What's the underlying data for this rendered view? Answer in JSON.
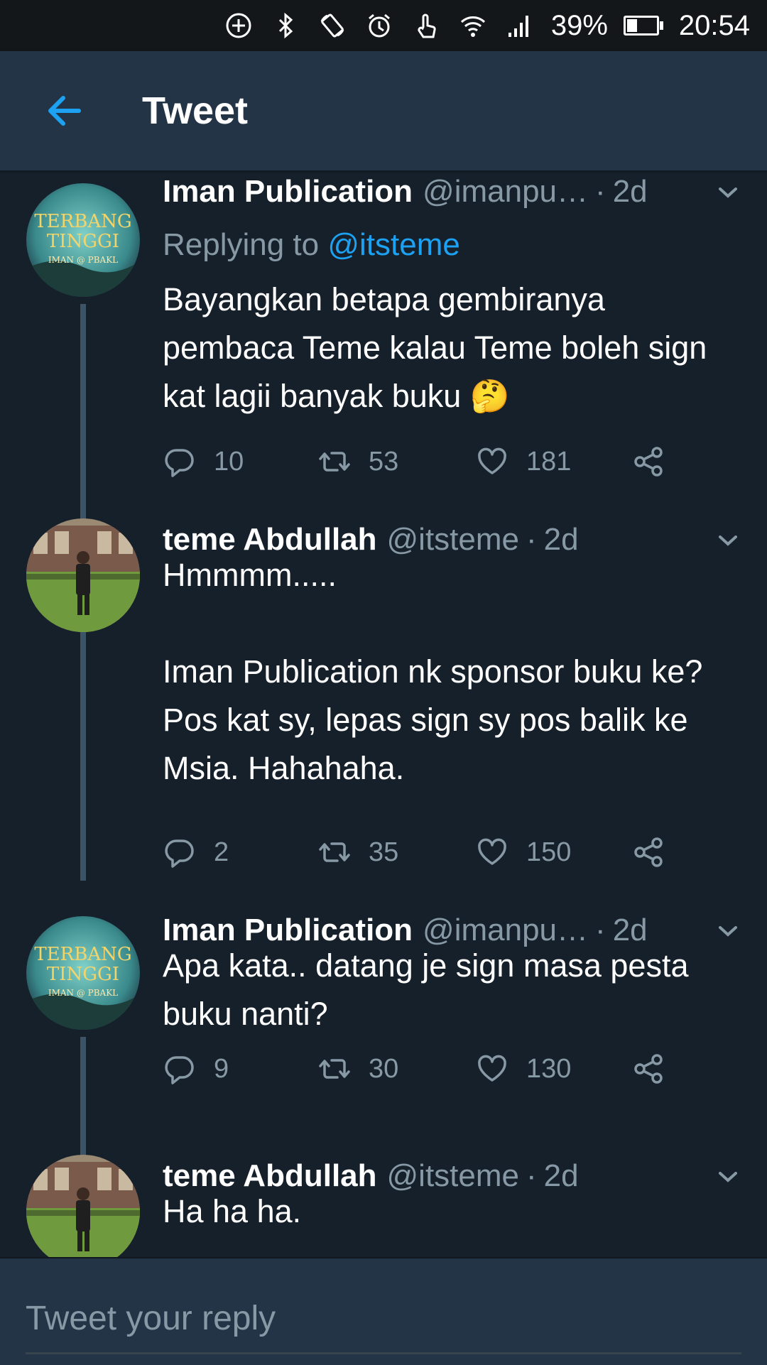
{
  "status_bar": {
    "battery_percent": "39%",
    "time": "20:54",
    "icons": [
      "add-circle-icon",
      "bluetooth-icon",
      "rotate-icon",
      "alarm-icon",
      "touch-icon",
      "wifi-icon",
      "signal-icon",
      "battery-icon"
    ]
  },
  "header": {
    "back_icon": "arrow-left-icon",
    "title": "Tweet"
  },
  "colors": {
    "background": "#15202b",
    "header": "#243447",
    "accent": "#1da1f2",
    "secondary_text": "#8899a6"
  },
  "tweets": [
    {
      "name": "Iman Publication",
      "handle": "@imanpu…",
      "dot": "·",
      "time": "2d",
      "replying_prefix": "Replying to ",
      "replying_to": "@itsteme",
      "text": "Bayangkan betapa gembiranya pembaca Teme kalau Teme boleh sign kat lagii banyak buku 🤔",
      "replies": "10",
      "retweets": "53",
      "likes": "181"
    },
    {
      "name": "teme Abdullah",
      "handle": "@itsteme",
      "dot": "·",
      "time": "2d",
      "text": "Hmmmm.....\n\nIman Publication nk sponsor buku ke? Pos kat sy, lepas sign sy pos balik ke Msia. Hahahaha.",
      "replies": "2",
      "retweets": "35",
      "likes": "150"
    },
    {
      "name": "Iman Publication",
      "handle": "@imanpu…",
      "dot": "·",
      "time": "2d",
      "text": "Apa kata.. datang je sign masa pesta buku nanti?",
      "replies": "9",
      "retweets": "30",
      "likes": "130"
    },
    {
      "name": "teme Abdullah",
      "handle": "@itsteme",
      "dot": "·",
      "time": "2d",
      "text": "Ha ha ha."
    }
  ],
  "avatar_text": {
    "line1": "TERBANG",
    "line2": "TINGGI",
    "line3": "IMAN @ PBAKL"
  },
  "reply_bar": {
    "placeholder": "Tweet your reply"
  }
}
